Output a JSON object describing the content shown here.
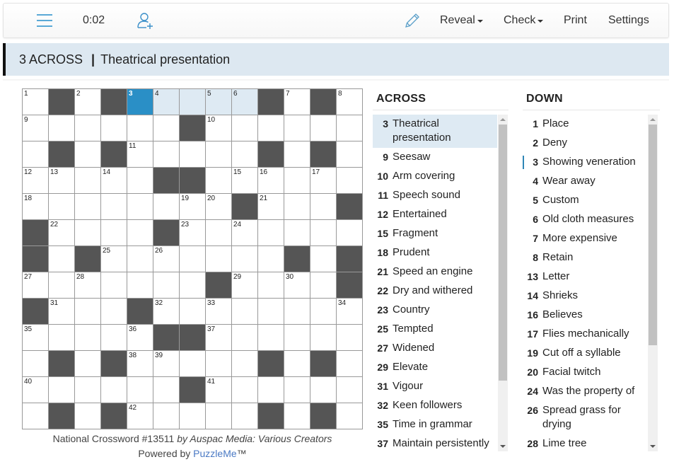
{
  "toolbar": {
    "menu_icon": "hamburger-icon",
    "timer": "0:02",
    "add_user_icon": "add-user-icon",
    "pencil_icon": "pencil-icon",
    "reveal": "Reveal",
    "check": "Check",
    "print": "Print",
    "settings": "Settings"
  },
  "current_clue": {
    "label": "3 ACROSS",
    "separator": "|",
    "text": "Theatrical presentation"
  },
  "grid": {
    "size": 13,
    "rows": [
      "1#2#34_56#7#8",
      "9_____#______",
      "_#_#_____#_#_",
      "_____##______",
      "________#___#",
      "#____#_______",
      "#_#_______#_#",
      "_______#____#",
      "#___#________",
      "_____##______",
      "_#_#_____#_#_",
      "______#______",
      "_#_#_____#_#_"
    ],
    "numbers": [
      {
        "r": 0,
        "c": 0,
        "n": "1"
      },
      {
        "r": 0,
        "c": 2,
        "n": "2"
      },
      {
        "r": 0,
        "c": 4,
        "n": "3"
      },
      {
        "r": 0,
        "c": 5,
        "n": "4"
      },
      {
        "r": 0,
        "c": 7,
        "n": "5"
      },
      {
        "r": 0,
        "c": 8,
        "n": "6"
      },
      {
        "r": 0,
        "c": 10,
        "n": "7"
      },
      {
        "r": 0,
        "c": 12,
        "n": "8"
      },
      {
        "r": 1,
        "c": 0,
        "n": "9"
      },
      {
        "r": 1,
        "c": 7,
        "n": "10"
      },
      {
        "r": 2,
        "c": 4,
        "n": "11"
      },
      {
        "r": 3,
        "c": 0,
        "n": "12"
      },
      {
        "r": 3,
        "c": 1,
        "n": "13"
      },
      {
        "r": 3,
        "c": 3,
        "n": "14"
      },
      {
        "r": 3,
        "c": 8,
        "n": "15"
      },
      {
        "r": 3,
        "c": 9,
        "n": "16"
      },
      {
        "r": 3,
        "c": 11,
        "n": "17"
      },
      {
        "r": 4,
        "c": 0,
        "n": "18"
      },
      {
        "r": 4,
        "c": 6,
        "n": "19"
      },
      {
        "r": 4,
        "c": 7,
        "n": "20"
      },
      {
        "r": 4,
        "c": 9,
        "n": "21"
      },
      {
        "r": 5,
        "c": 1,
        "n": "22"
      },
      {
        "r": 5,
        "c": 6,
        "n": "23"
      },
      {
        "r": 5,
        "c": 8,
        "n": "24"
      },
      {
        "r": 6,
        "c": 3,
        "n": "25"
      },
      {
        "r": 6,
        "c": 5,
        "n": "26"
      },
      {
        "r": 7,
        "c": 0,
        "n": "27"
      },
      {
        "r": 7,
        "c": 2,
        "n": "28"
      },
      {
        "r": 7,
        "c": 8,
        "n": "29"
      },
      {
        "r": 7,
        "c": 10,
        "n": "30"
      },
      {
        "r": 8,
        "c": 1,
        "n": "31"
      },
      {
        "r": 8,
        "c": 5,
        "n": "32"
      },
      {
        "r": 8,
        "c": 7,
        "n": "33"
      },
      {
        "r": 8,
        "c": 12,
        "n": "34"
      },
      {
        "r": 9,
        "c": 0,
        "n": "35"
      },
      {
        "r": 9,
        "c": 4,
        "n": "36"
      },
      {
        "r": 9,
        "c": 7,
        "n": "37"
      },
      {
        "r": 10,
        "c": 4,
        "n": "38"
      },
      {
        "r": 10,
        "c": 5,
        "n": "39"
      },
      {
        "r": 11,
        "c": 0,
        "n": "40"
      },
      {
        "r": 11,
        "c": 7,
        "n": "41"
      },
      {
        "r": 12,
        "c": 4,
        "n": "42"
      }
    ],
    "selected": {
      "r": 0,
      "c": 4
    },
    "highlighted_word": [
      {
        "r": 0,
        "c": 4
      },
      {
        "r": 0,
        "c": 5
      },
      {
        "r": 0,
        "c": 6
      },
      {
        "r": 0,
        "c": 7
      },
      {
        "r": 0,
        "c": 8
      }
    ],
    "colors": {
      "black": "#555555",
      "selected": "#2a8fc6",
      "word": "#deeaf3"
    }
  },
  "footer": {
    "title": "National Crossword #13511",
    "byline": "by Auspac Media: Various Creators",
    "powered_by": "Powered by",
    "brand": "PuzzleMe",
    "tm": "™"
  },
  "across": {
    "heading": "ACROSS",
    "clues": [
      {
        "num": "3",
        "text": "Theatrical presentation",
        "active": true
      },
      {
        "num": "9",
        "text": "Seesaw"
      },
      {
        "num": "10",
        "text": "Arm covering"
      },
      {
        "num": "11",
        "text": "Speech sound"
      },
      {
        "num": "12",
        "text": "Entertained"
      },
      {
        "num": "15",
        "text": "Fragment"
      },
      {
        "num": "18",
        "text": "Prudent"
      },
      {
        "num": "21",
        "text": "Speed an engine"
      },
      {
        "num": "22",
        "text": "Dry and withered"
      },
      {
        "num": "23",
        "text": "Country"
      },
      {
        "num": "25",
        "text": "Tempted"
      },
      {
        "num": "27",
        "text": "Widened"
      },
      {
        "num": "29",
        "text": "Elevate"
      },
      {
        "num": "31",
        "text": "Vigour"
      },
      {
        "num": "32",
        "text": "Keen followers"
      },
      {
        "num": "35",
        "text": "Time in grammar"
      },
      {
        "num": "37",
        "text": "Maintain persistently"
      }
    ]
  },
  "down": {
    "heading": "DOWN",
    "clues": [
      {
        "num": "1",
        "text": "Place"
      },
      {
        "num": "2",
        "text": "Deny"
      },
      {
        "num": "3",
        "text": "Showing veneration",
        "cross": true
      },
      {
        "num": "4",
        "text": "Wear away"
      },
      {
        "num": "5",
        "text": "Custom"
      },
      {
        "num": "6",
        "text": "Old cloth measures"
      },
      {
        "num": "7",
        "text": "More expensive"
      },
      {
        "num": "8",
        "text": "Retain"
      },
      {
        "num": "13",
        "text": "Letter"
      },
      {
        "num": "14",
        "text": "Shrieks"
      },
      {
        "num": "16",
        "text": "Believes"
      },
      {
        "num": "17",
        "text": "Flies mechanically"
      },
      {
        "num": "19",
        "text": "Cut off a syllable"
      },
      {
        "num": "20",
        "text": "Facial twitch"
      },
      {
        "num": "24",
        "text": "Was the property of"
      },
      {
        "num": "26",
        "text": "Spread grass for drying"
      },
      {
        "num": "28",
        "text": "Lime tree"
      }
    ]
  }
}
